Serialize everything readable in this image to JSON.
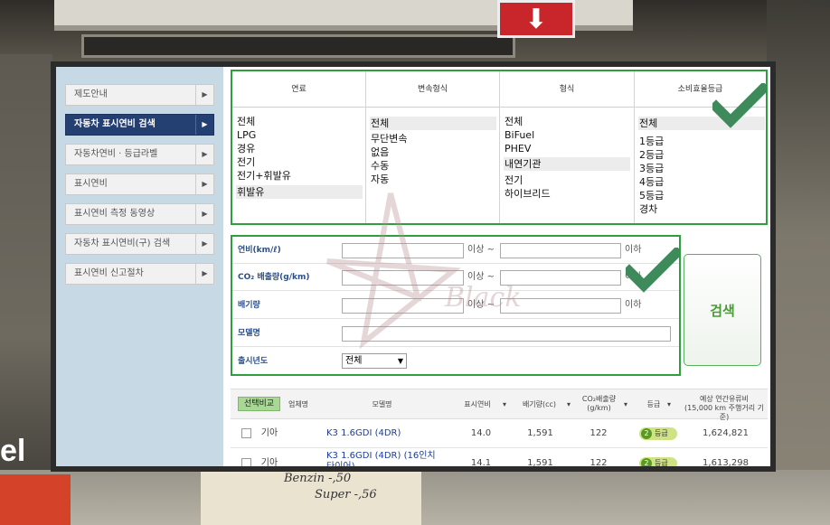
{
  "sidebar": {
    "items": [
      {
        "label": "제도안내"
      },
      {
        "label": "자동차 표시연비 검색"
      },
      {
        "label": "자동차연비 · 등급라벨"
      },
      {
        "label": "표시연비"
      },
      {
        "label": "표시연비 측정 동영상"
      },
      {
        "label": "자동차 표시연비(구) 검색"
      },
      {
        "label": "표시연비 신고절차"
      }
    ],
    "active_index": 1
  },
  "filters": {
    "fuel": {
      "header": "연료",
      "options": [
        "전체",
        "LPG",
        "경유",
        "전기",
        "전기+휘발유",
        "휘발유"
      ],
      "selected": "휘발유"
    },
    "transmission": {
      "header": "변속형식",
      "options": [
        "전체",
        "무단변속",
        "없음",
        "수동",
        "자동"
      ],
      "selected": "전체"
    },
    "type": {
      "header": "형식",
      "options": [
        "전체",
        "BiFuel",
        "PHEV",
        "내연기관",
        "전기",
        "하이브리드"
      ],
      "selected": "내연기관"
    },
    "efficiency_grade": {
      "header": "소비효율등급",
      "options": [
        "전체",
        "1등급",
        "2등급",
        "3등급",
        "4등급",
        "5등급",
        "경차"
      ],
      "selected": "전체"
    }
  },
  "search_form": {
    "fuel_economy_label": "연비(km/ℓ)",
    "co2_label": "CO₂ 배출량(g/km)",
    "displacement_label": "배기량",
    "model_label": "모델명",
    "year_label": "출시년도",
    "range_from_text": "이상 ~",
    "range_to_text": "이하",
    "year_value": "전체"
  },
  "search_button": "검색",
  "results": {
    "compare_button": "선택비교",
    "columns": {
      "maker": "업체명",
      "model": "모델명",
      "fuel_economy": "표시연비",
      "displacement": "배기량(cc)",
      "co2_line1": "CO₂배출량",
      "co2_line2": "(g/km)",
      "grade": "등급",
      "annual_cost_line1": "예상 연간유류비",
      "annual_cost_line2": "(15,000 km 주행거리 기준)"
    },
    "rows": [
      {
        "maker": "기아",
        "model": "K3 1.6GDI (4DR)",
        "model_line2": "",
        "fuel_economy": "14.0",
        "displacement": "1,591",
        "co2": "122",
        "grade_num": "2",
        "grade_text": "등급",
        "annual_cost": "1,624,821"
      },
      {
        "maker": "기아",
        "model": "K3 1.6GDI (4DR) (16인치",
        "model_line2": "타이어)",
        "fuel_economy": "14.1",
        "displacement": "1,591",
        "co2": "122",
        "grade_num": "2",
        "grade_text": "등급",
        "annual_cost": "1,613,298"
      }
    ]
  },
  "background": {
    "poster_line1": "Benzin -,50",
    "poster_line2": "Super -,56",
    "left_sign": "el",
    "arrow_sign": "⬇"
  },
  "watermark": "Black",
  "colors": {
    "highlight_box": "#2e9e3e",
    "sidebar_active": "#243f72",
    "sidebar_bg": "#c8d9e6",
    "search_text": "#4a9a38",
    "grade_badge": "#cfe384"
  }
}
